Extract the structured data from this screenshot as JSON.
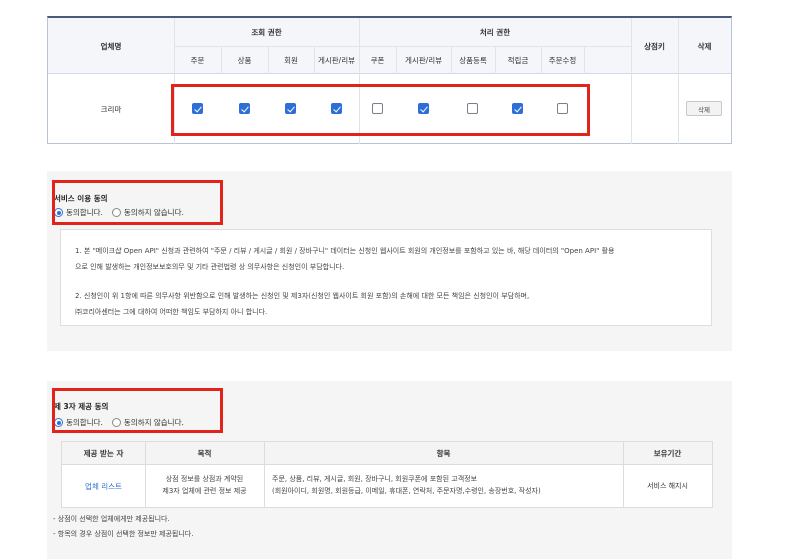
{
  "permission_table": {
    "headers": {
      "company_name": "업체명",
      "view_permission": "조회 권한",
      "process_permission": "처리 권한",
      "sync_key": "상점키",
      "delete": "삭제"
    },
    "view_columns": [
      "주문",
      "상품",
      "회원",
      "게시판/리뷰"
    ],
    "process_columns": [
      "쿠폰",
      "게시판/리뷰",
      "상품등록",
      "적립금",
      "주문수정"
    ],
    "rows": [
      {
        "company": "크리마",
        "view_checks": [
          true,
          true,
          true,
          true
        ],
        "process_checks": [
          false,
          true,
          false,
          true,
          false
        ],
        "sync_key": "",
        "delete_label": "삭제"
      }
    ]
  },
  "service_consent": {
    "title": "서비스 이용 동의",
    "agree_label": "동의합니다.",
    "disagree_label": "동의하지 않습니다.",
    "selected": "agree",
    "notice_line1": "1. 본 \"메이크샵 Open API\" 신청과 관련하여 \"주문 / 리뷰 / 게시글 / 회원 / 장바구니\" 데이터는 신청인 웹사이트 회원의 개인정보를 포함하고 있는 바, 해당 데이터의 \"Open API\" 활용",
    "notice_line2": "으로 인해 발생하는 개인정보보호의무 및 기타 관련법령 상 의무사항은 신청인이 부담합니다.",
    "notice_line3": "2. 신청인이 위 1항에 따른 의무사항 위반함으로 인해 발생하는 신청인 및 제3자(신청인 웹사이트 회원 포함)의 손해에 대한 모든 책임은 신청인이 부담하며,",
    "notice_line4": "㈜코리아센터는 그에 대하여 어떠한 책임도 부담하지 아니 합니다."
  },
  "third_party_consent": {
    "title": "제 3자 제공 동의",
    "agree_label": "동의합니다.",
    "disagree_label": "동의하지 않습니다.",
    "selected": "agree",
    "table": {
      "headers": [
        "제공 받는 자",
        "목적",
        "항목",
        "보유기간"
      ],
      "row": {
        "recipient": "업체 리스트",
        "purpose_line1": "상점 정보를 상점과 계약된",
        "purpose_line2": "제3자 업체에 관련 정보 제공",
        "items_line1": "주문, 상품, 리뷰, 게시글, 회원, 장바구니, 회원쿠폰에 포함된 고객정보",
        "items_line2": "(회원아이디, 회원명, 회원등급, 이메일, 휴대폰, 연락처, 주문자명,수령인, 송장번호, 작성자)",
        "retention": "서비스 해지시"
      }
    },
    "notes": [
      "- 상점이 선택한 업체에게만 제공됩니다.",
      "- 항목의 경우 상점이 선택한 정보만 제공됩니다."
    ]
  },
  "colors": {
    "accent_blue": "#2d6fd6",
    "highlight_red": "#e2231a",
    "header_navy": "#4a5a7a"
  }
}
